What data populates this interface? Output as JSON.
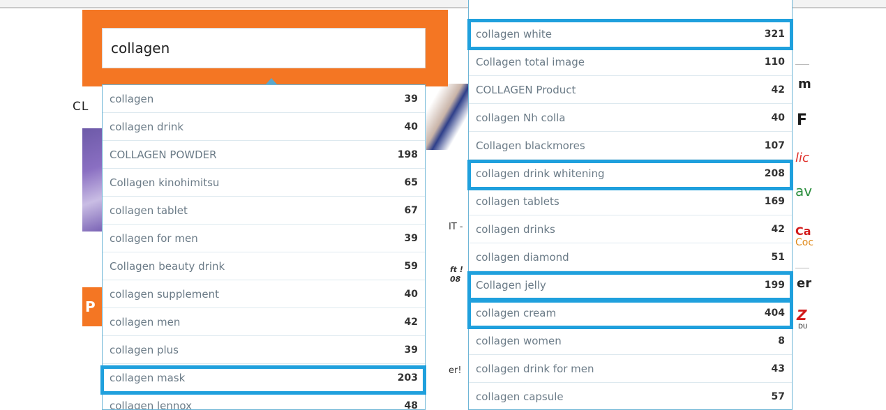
{
  "search": {
    "value": "collagen"
  },
  "left_suggestions": [
    {
      "text": "collagen",
      "count": "39"
    },
    {
      "text": "collagen drink",
      "count": "40"
    },
    {
      "text": "COLLAGEN POWDER",
      "count": "198"
    },
    {
      "text": "Collagen kinohimitsu",
      "count": "65"
    },
    {
      "text": "collagen tablet",
      "count": "67"
    },
    {
      "text": "collagen for men",
      "count": "39"
    },
    {
      "text": "Collagen beauty drink",
      "count": "59"
    },
    {
      "text": "collagen supplement",
      "count": "40"
    },
    {
      "text": "collagen men",
      "count": "42"
    },
    {
      "text": "collagen plus",
      "count": "39"
    },
    {
      "text": "collagen mask",
      "count": "203"
    },
    {
      "text": "collagen lennox",
      "count": "48"
    }
  ],
  "right_suggestions": [
    {
      "text": "collagen white",
      "count": "321"
    },
    {
      "text": "Collagen total image",
      "count": "110"
    },
    {
      "text": "COLLAGEN Product",
      "count": "42"
    },
    {
      "text": "collagen Nh colla",
      "count": "40"
    },
    {
      "text": "Collagen blackmores",
      "count": "107"
    },
    {
      "text": "collagen drink whitening",
      "count": "208"
    },
    {
      "text": "collagen tablets",
      "count": "169"
    },
    {
      "text": "collagen drinks",
      "count": "42"
    },
    {
      "text": "collagen diamond",
      "count": "51"
    },
    {
      "text": "Collagen jelly",
      "count": "199"
    },
    {
      "text": "collagen cream",
      "count": "404"
    },
    {
      "text": "collagen women",
      "count": "8"
    },
    {
      "text": "collagen drink for men",
      "count": "43"
    },
    {
      "text": "collagen capsule",
      "count": "57"
    }
  ],
  "background": {
    "left_text_1": "CL",
    "left_text_2": "P",
    "mid_text_1": "IT -",
    "mid_text_2": "ft !",
    "mid_text_3": "08",
    "mid_text_4": "er!",
    "right_text_1": "m",
    "right_text_2": "F",
    "right_text_3": "lic",
    "right_text_4": "av",
    "right_text_5": "Ca",
    "right_text_6": "Coc",
    "right_text_7": "er",
    "right_text_8": "Z",
    "right_text_9": "DU"
  },
  "colors": {
    "accent": "#f47623",
    "highlight": "#1fa0dd",
    "list_border": "#6db5d6"
  }
}
